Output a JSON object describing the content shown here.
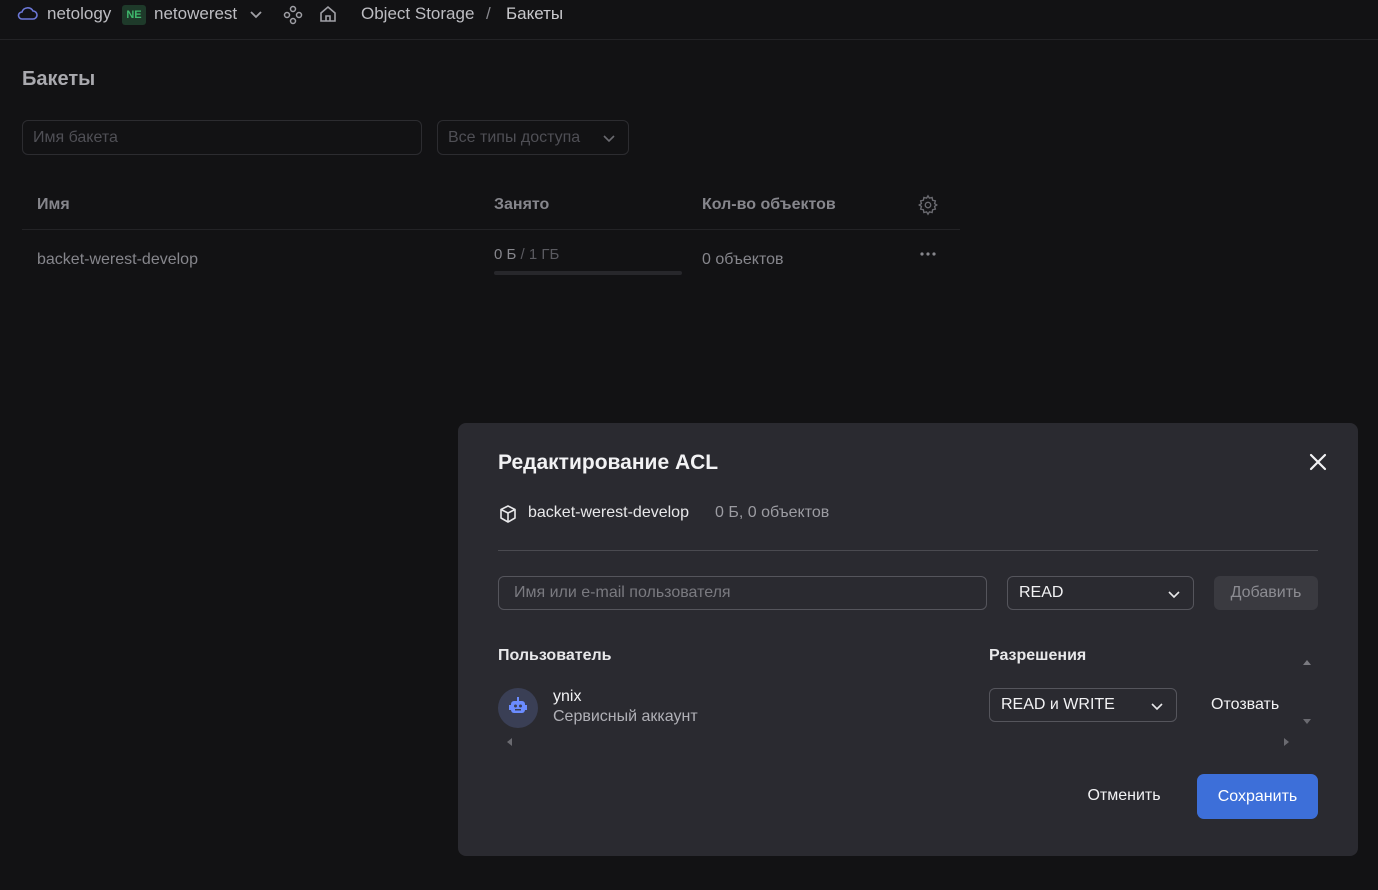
{
  "header": {
    "org_name": "netology",
    "cloud_badge": "NE",
    "cloud_name": "netowerest",
    "breadcrumb": [
      "Object Storage",
      "Бакеты"
    ],
    "breadcrumb_separator": "/"
  },
  "page": {
    "title": "Бакеты",
    "search_placeholder": "Имя бакета",
    "access_filter_placeholder": "Все типы доступа"
  },
  "table": {
    "columns": [
      "Имя",
      "Занято",
      "Кол-во объектов"
    ],
    "rows": [
      {
        "name": "backet-werest-develop",
        "used": "0 Б",
        "quota": " / 1 ГБ",
        "used_fraction": 0,
        "objects": "0 объектов"
      }
    ]
  },
  "modal": {
    "title": "Редактирование ACL",
    "bucket_name": "backet-werest-develop",
    "bucket_meta": "0 Б, 0 объектов",
    "user_input_placeholder": "Имя или e-mail пользователя",
    "permission_select": "READ",
    "add_label": "Добавить",
    "col_user": "Пользователь",
    "col_permissions": "Разрешения",
    "entries": [
      {
        "name": "ynix",
        "role": "Сервисный аккаунт",
        "permission": "READ и WRITE",
        "revoke_label": "Отозвать"
      }
    ],
    "cancel_label": "Отменить",
    "save_label": "Сохранить"
  },
  "colors": {
    "accent": "#3d6fd9",
    "background": "#121214",
    "modal_background": "#2a2a30",
    "badge_green": "#3fb96d"
  },
  "icons": [
    "cloud-icon",
    "chevron-down-icon",
    "services-icon",
    "home-icon",
    "gear-icon",
    "more-icon",
    "close-icon",
    "bucket-icon",
    "robot-icon",
    "sort-up-icon",
    "sort-down-icon",
    "scroll-left-icon",
    "scroll-right-icon"
  ]
}
